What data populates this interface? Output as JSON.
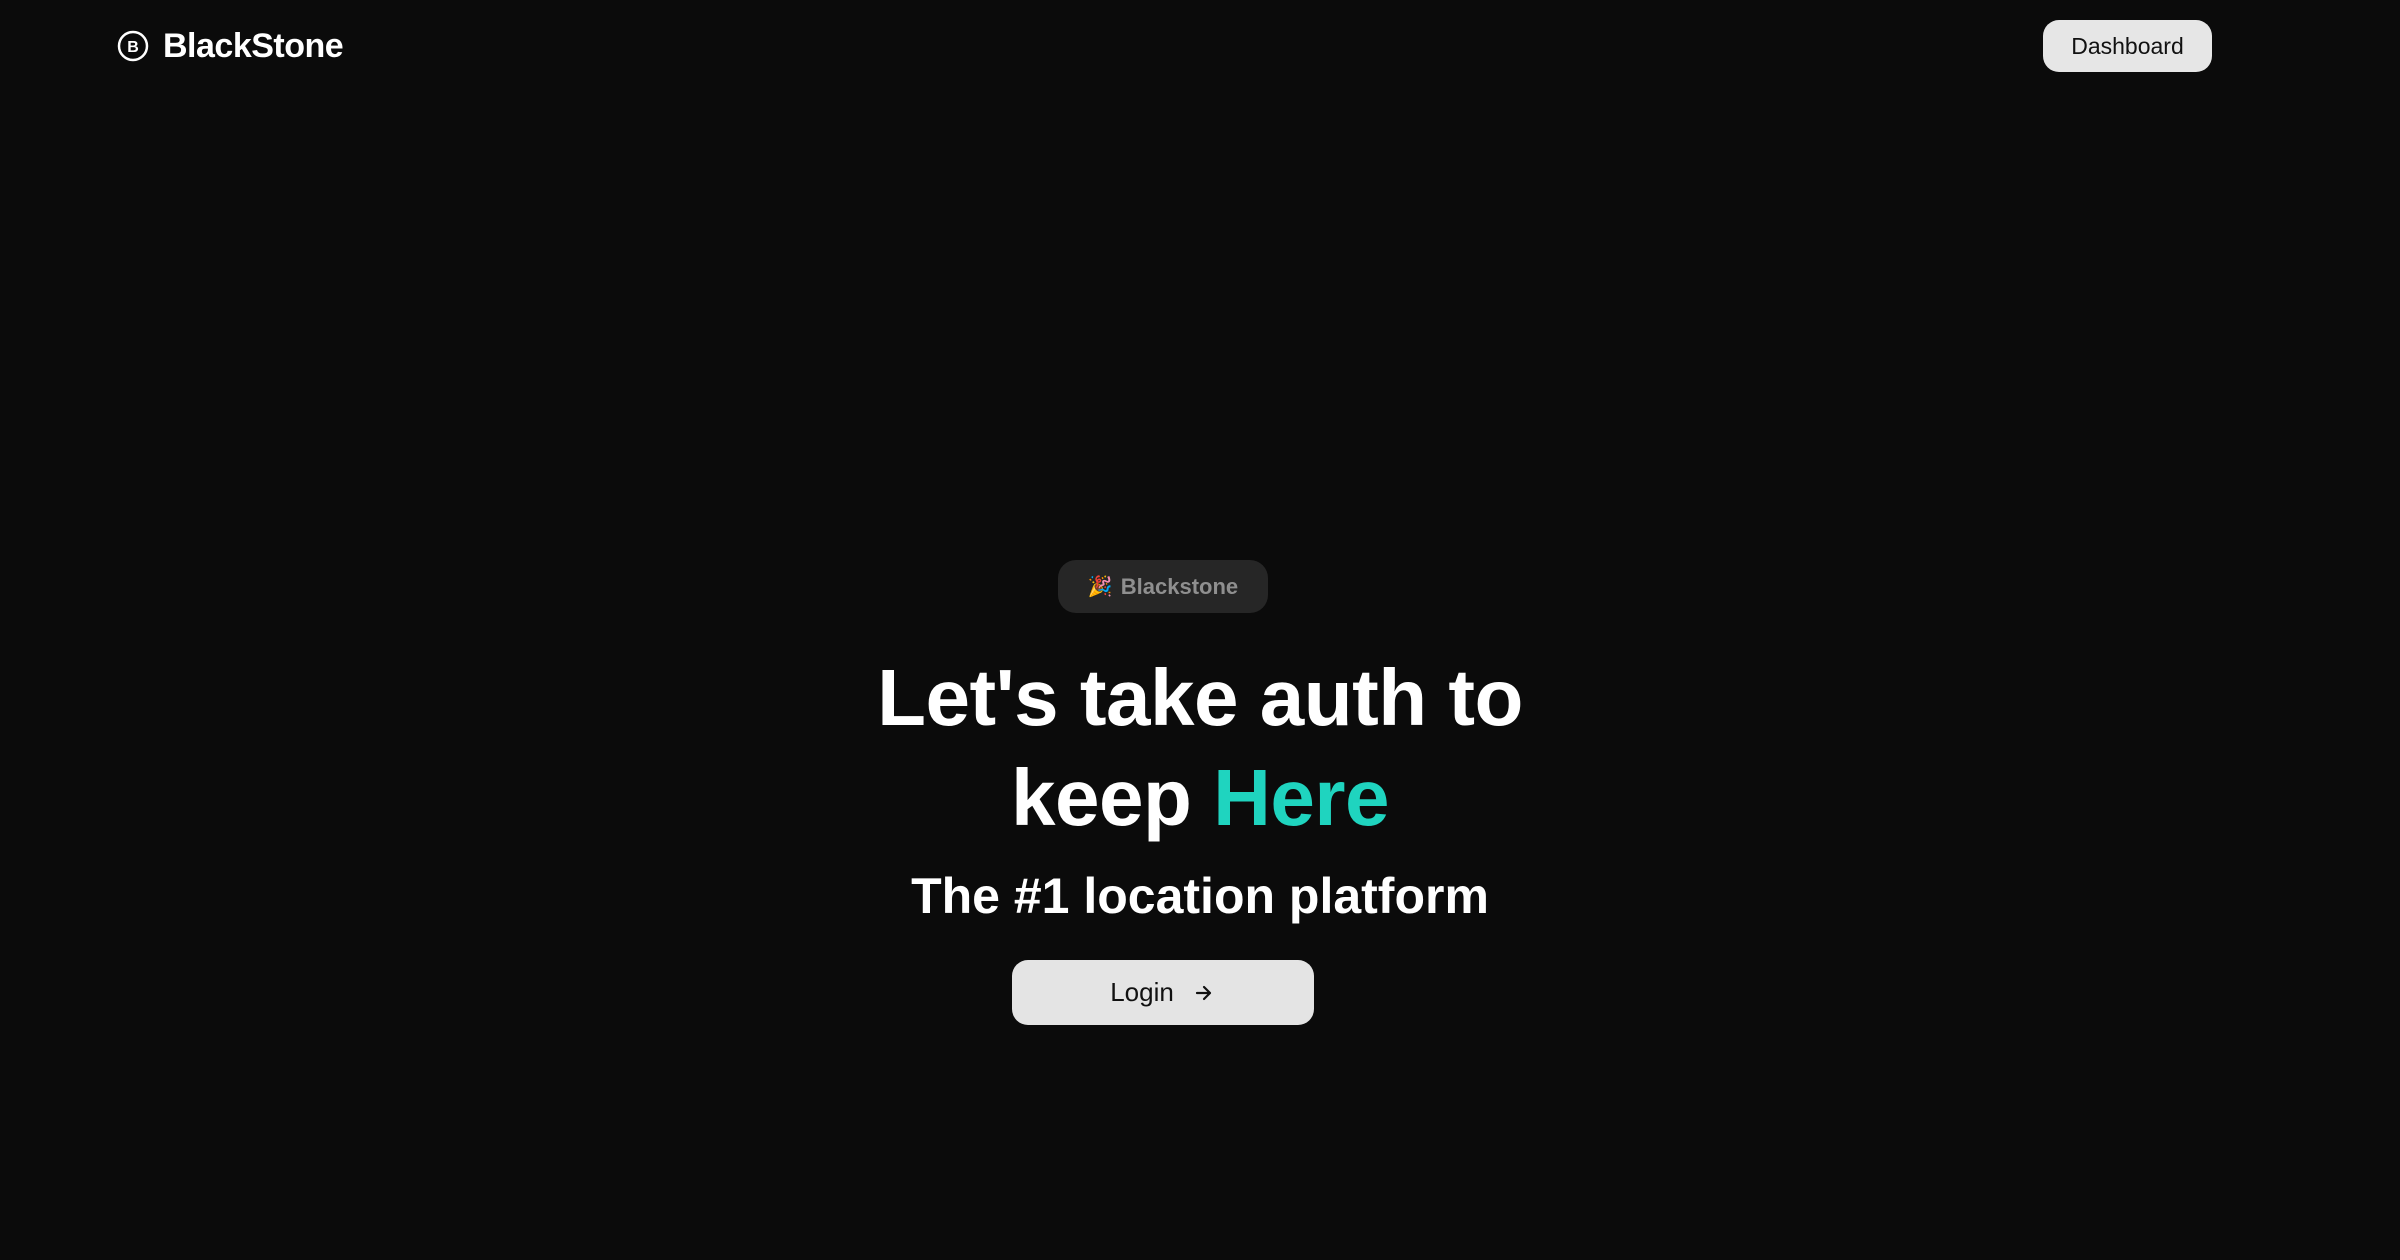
{
  "header": {
    "brand_name": "BlackStone",
    "brand_icon_letter": "B",
    "dashboard_label": "Dashboard"
  },
  "hero": {
    "badge_emoji": "🎉",
    "badge_label": "Blackstone",
    "headline_line1": "Let's take auth to",
    "headline_line2_prefix": "keep ",
    "headline_accent": "Here",
    "subheadline": "The #1 location platform",
    "login_label": "Login"
  },
  "icons": {
    "brand": "b-circle-icon",
    "badge": "party-popper-icon",
    "login": "arrow-right-icon"
  },
  "colors": {
    "background": "#0b0b0b",
    "accent": "#1fd4bf",
    "button_bg": "#e4e4e4",
    "badge_bg": "#262626"
  }
}
